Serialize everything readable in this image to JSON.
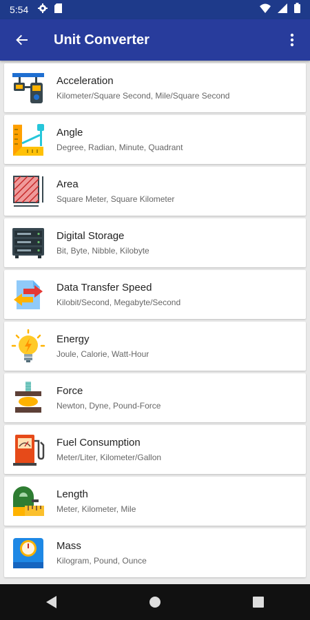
{
  "status": {
    "time": "5:54"
  },
  "app_bar": {
    "title": "Unit Converter"
  },
  "items": [
    {
      "title": "Acceleration",
      "subtitle": "Kilometer/Square Second, Mile/Square Second",
      "icon": "acceleration-icon"
    },
    {
      "title": "Angle",
      "subtitle": "Degree, Radian, Minute, Quadrant",
      "icon": "angle-icon"
    },
    {
      "title": "Area",
      "subtitle": "Square Meter, Square Kilometer",
      "icon": "area-icon"
    },
    {
      "title": "Digital Storage",
      "subtitle": "Bit, Byte, Nibble, Kilobyte",
      "icon": "server-icon"
    },
    {
      "title": "Data Transfer Speed",
      "subtitle": "Kilobit/Second, Megabyte/Second",
      "icon": "data-transfer-icon"
    },
    {
      "title": "Energy",
      "subtitle": "Joule, Calorie, Watt-Hour",
      "icon": "lightbulb-icon"
    },
    {
      "title": "Force",
      "subtitle": "Newton, Dyne, Pound-Force",
      "icon": "press-icon"
    },
    {
      "title": "Fuel Consumption",
      "subtitle": "Meter/Liter, Kilometer/Gallon",
      "icon": "fuel-pump-icon"
    },
    {
      "title": "Length",
      "subtitle": "Meter, Kilometer, Mile",
      "icon": "tape-measure-icon"
    },
    {
      "title": "Mass",
      "subtitle": "Kilogram, Pound, Ounce",
      "icon": "scale-icon"
    }
  ],
  "colors": {
    "status_bar": "#1e3a8a",
    "app_bar": "#283c9c",
    "background": "#e9e9e9",
    "nav_bar": "#111111"
  }
}
